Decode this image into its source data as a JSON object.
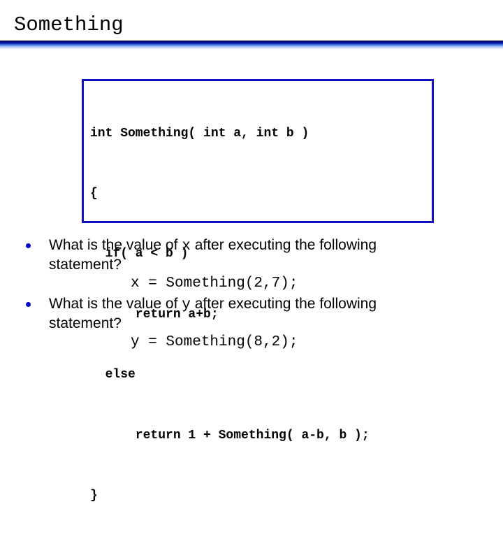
{
  "slide": {
    "title": "Something"
  },
  "code_box": {
    "lines": [
      "int Something( int a, int b )",
      "{",
      "  if( a < b )",
      "      return a+b;",
      "  else",
      "      return 1 + Something( a-b, b );",
      "}"
    ]
  },
  "questions": [
    {
      "prefix": "What is the value of ",
      "variable": "x",
      "suffix": " after executing the following statement?",
      "statement": "x = Something(2,7);"
    },
    {
      "prefix": "What is the value of ",
      "variable": "y",
      "suffix": " after executing the following statement?",
      "statement": "y = Something(8,2);"
    }
  ],
  "colors": {
    "accent": "#1212c8",
    "bullet": "#0000cc",
    "rule_dark": "#00008a",
    "rule_light": "#8fb1f2"
  }
}
